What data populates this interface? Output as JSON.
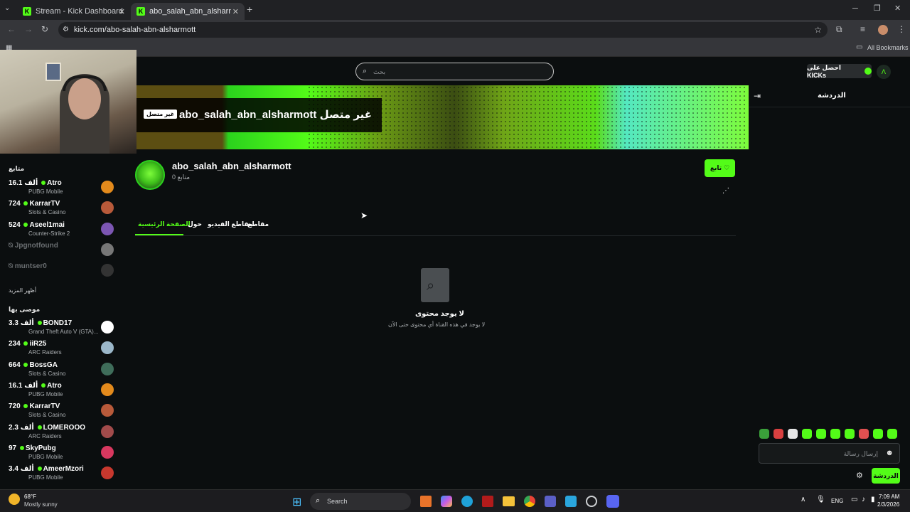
{
  "browser": {
    "tabs": [
      {
        "title": "Stream - Kick Dashboard"
      },
      {
        "title": "abo_salah_abn_alsharmott Stre..."
      }
    ],
    "new_tab_icon": "plus-icon",
    "url": "kick.com/abo-salah-abn-alsharmott",
    "bookmarks_label": "All Bookmarks"
  },
  "header": {
    "search_placeholder": "بحث",
    "get_kicks_label": "احصل على KICKs"
  },
  "banner": {
    "offline_badge": "غير متصل",
    "offline_title": "abo_salah_abn_alsharmott غير متصل"
  },
  "channel": {
    "username": "abo_salah_abn_alsharmott",
    "followers": "0 متابع",
    "follow_label": "تابع"
  },
  "tabs": [
    {
      "label": "الصفحة الرئيسية",
      "active": true
    },
    {
      "label": "حول",
      "active": false
    },
    {
      "label": "مقاطع الفيديو",
      "active": false
    },
    {
      "label": "مقاطع",
      "active": false
    }
  ],
  "empty_state": {
    "title": "لا يوجد محتوى",
    "subtitle": "لا يوجد في هذه القناة أي محتوى حتى الآن"
  },
  "chat": {
    "title": "الدردشة",
    "input_placeholder": "إرسال رسالة",
    "send_label": "الدردشة"
  },
  "sidebar": {
    "following_heading": "متابع",
    "following": [
      {
        "name": "Atro",
        "viewers": "16.1 ألف",
        "game": "PUBG Mobile",
        "online": true,
        "color": "#e38a1c"
      },
      {
        "name": "KarrarTV",
        "viewers": "724",
        "game": "Slots & Casino",
        "online": true,
        "color": "#b85a3a"
      },
      {
        "name": "Aseel1mai",
        "viewers": "524",
        "game": "Counter-Strike 2",
        "online": true,
        "color": "#7c56b3"
      },
      {
        "name": "Jpgnotfound",
        "viewers": "",
        "game": "",
        "online": false,
        "color": "#777777"
      },
      {
        "name": "muntser0",
        "viewers": "",
        "game": "",
        "online": false,
        "color": "#333333"
      }
    ],
    "show_more": "أظهر المزيد",
    "recommended_heading": "موصى بها",
    "recommended": [
      {
        "name": "BOND17",
        "viewers": "3.3 ألف",
        "game": "Grand Theft Auto V (GTA)...",
        "color": "#ffffff"
      },
      {
        "name": "iiR25",
        "viewers": "234",
        "game": "ARC Raiders",
        "color": "#9bb7c9"
      },
      {
        "name": "BossGA",
        "viewers": "664",
        "game": "Slots & Casino",
        "color": "#3f6d5a"
      },
      {
        "name": "Atro",
        "viewers": "16.1 ألف",
        "game": "PUBG Mobile",
        "color": "#e38a1c"
      },
      {
        "name": "KarrarTV",
        "viewers": "720",
        "game": "Slots & Casino",
        "color": "#b85a3a"
      },
      {
        "name": "LOMEROOO",
        "viewers": "2.3 ألف",
        "game": "ARC Raiders",
        "color": "#a24b4b"
      },
      {
        "name": "SkyPubg",
        "viewers": "97",
        "game": "PUBG Mobile",
        "color": "#d8385f"
      },
      {
        "name": "AmeerMzori",
        "viewers": "3.4 ألف",
        "game": "PUBG Mobile",
        "color": "#c8382e"
      }
    ]
  },
  "taskbar": {
    "weather_temp": "68°F",
    "weather_desc": "Mostly sunny",
    "search_label": "Search",
    "language": "ENG",
    "time": "7:09 AM",
    "date": "2/3/2026"
  }
}
